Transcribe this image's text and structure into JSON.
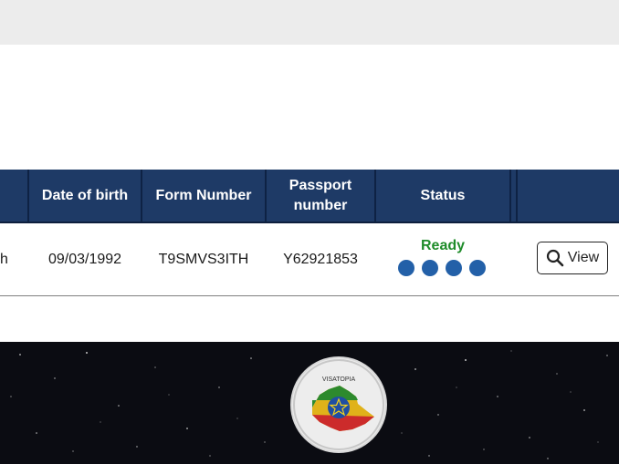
{
  "table": {
    "headers": {
      "date_of_birth": "Date of birth",
      "form_number": "Form Number",
      "passport_number": "Passport number",
      "status": "Status"
    },
    "row": {
      "name_fragment": "h",
      "date_of_birth": "09/03/1992",
      "form_number": "T9SMVS3ITH",
      "passport_number": "Y62921853",
      "status": "Ready",
      "progress_steps_completed": 4,
      "progress_steps_total": 4,
      "action_label": "View"
    }
  },
  "footer": {
    "logo_text": "VISATOPIA"
  },
  "colors": {
    "header_bg": "#1e3a66",
    "status_ready": "#1f8c2a",
    "progress_dot": "#2360a8",
    "footer_bg": "#0b0c12"
  },
  "icons": {
    "view_button": "search-icon"
  }
}
